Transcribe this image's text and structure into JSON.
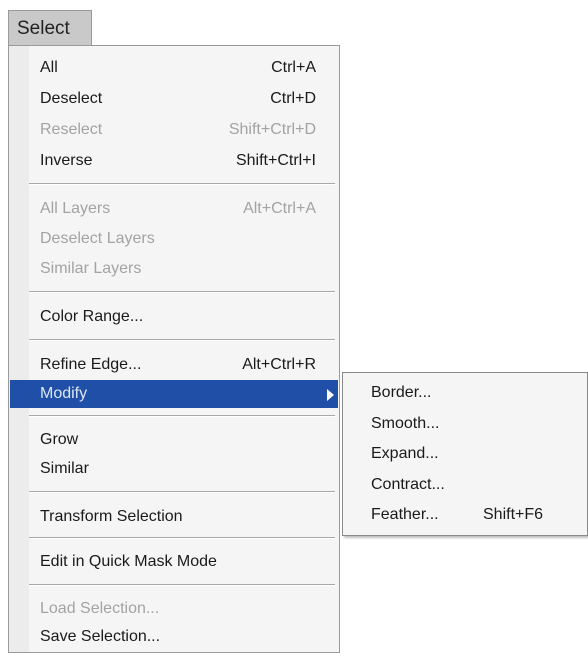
{
  "menubar": {
    "select_label": "Select"
  },
  "menu": {
    "items": [
      {
        "label": "All",
        "shortcut": "Ctrl+A"
      },
      {
        "label": "Deselect",
        "shortcut": "Ctrl+D"
      },
      {
        "label": "Reselect",
        "shortcut": "Shift+Ctrl+D"
      },
      {
        "label": "Inverse",
        "shortcut": "Shift+Ctrl+I"
      },
      {
        "label": "All Layers",
        "shortcut": "Alt+Ctrl+A"
      },
      {
        "label": "Deselect Layers",
        "shortcut": ""
      },
      {
        "label": "Similar Layers",
        "shortcut": ""
      },
      {
        "label": "Color Range...",
        "shortcut": ""
      },
      {
        "label": "Refine Edge...",
        "shortcut": "Alt+Ctrl+R"
      },
      {
        "label": "Modify",
        "shortcut": ""
      },
      {
        "label": "Grow",
        "shortcut": ""
      },
      {
        "label": "Similar",
        "shortcut": ""
      },
      {
        "label": "Transform Selection",
        "shortcut": ""
      },
      {
        "label": "Edit in Quick Mask Mode",
        "shortcut": ""
      },
      {
        "label": "Load Selection...",
        "shortcut": ""
      },
      {
        "label": "Save Selection...",
        "shortcut": ""
      }
    ]
  },
  "submenu": {
    "items": [
      {
        "label": "Border...",
        "shortcut": ""
      },
      {
        "label": "Smooth...",
        "shortcut": ""
      },
      {
        "label": "Expand...",
        "shortcut": ""
      },
      {
        "label": "Contract...",
        "shortcut": ""
      },
      {
        "label": "Feather...",
        "shortcut": "Shift+F6"
      }
    ]
  },
  "colors": {
    "highlight": "#1f4fa6",
    "disabled_text": "#a3a3a3",
    "menu_bg": "#f5f5f5"
  }
}
